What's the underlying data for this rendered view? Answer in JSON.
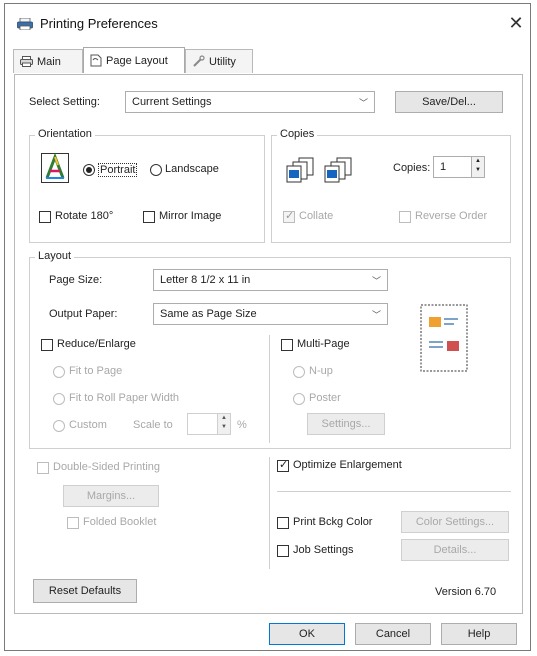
{
  "window": {
    "title": "Printing Preferences",
    "close": "✕"
  },
  "tabs": [
    {
      "label": "Main",
      "icon": "printer-icon"
    },
    {
      "label": "Page Layout",
      "icon": "page-layout-icon"
    },
    {
      "label": "Utility",
      "icon": "utility-icon"
    }
  ],
  "select_setting": {
    "label": "Select Setting:",
    "value": "Current Settings",
    "save_button": "Save/Del..."
  },
  "orientation": {
    "title": "Orientation",
    "portrait": "Portrait",
    "landscape": "Landscape",
    "rotate": "Rotate 180°",
    "mirror": "Mirror Image"
  },
  "copies": {
    "title": "Copies",
    "copies_label": "Copies:",
    "copies_value": "1",
    "collate": "Collate",
    "reverse": "Reverse Order"
  },
  "layout": {
    "title": "Layout",
    "page_size_label": "Page Size:",
    "page_size_value": "Letter 8 1/2 x 11 in",
    "output_paper_label": "Output Paper:",
    "output_paper_value": "Same as Page Size",
    "reduce_enlarge": "Reduce/Enlarge",
    "fit_to_page": "Fit to Page",
    "fit_to_roll": "Fit to Roll Paper Width",
    "custom": "Custom",
    "scale_to": "Scale to",
    "percent": "%",
    "multi_page": "Multi-Page",
    "n_up": "N-up",
    "poster": "Poster",
    "settings_button": "Settings..."
  },
  "duplex": {
    "double_sided": "Double-Sided Printing",
    "margins_button": "Margins...",
    "folded_booklet": "Folded Booklet"
  },
  "options": {
    "optimize_enlargement": "Optimize Enlargement",
    "print_bkg_color": "Print Bckg Color",
    "color_settings_button": "Color Settings...",
    "job_settings": "Job Settings",
    "details_button": "Details..."
  },
  "footer": {
    "reset_defaults": "Reset Defaults",
    "version": "Version 6.70",
    "ok": "OK",
    "cancel": "Cancel",
    "help": "Help"
  }
}
